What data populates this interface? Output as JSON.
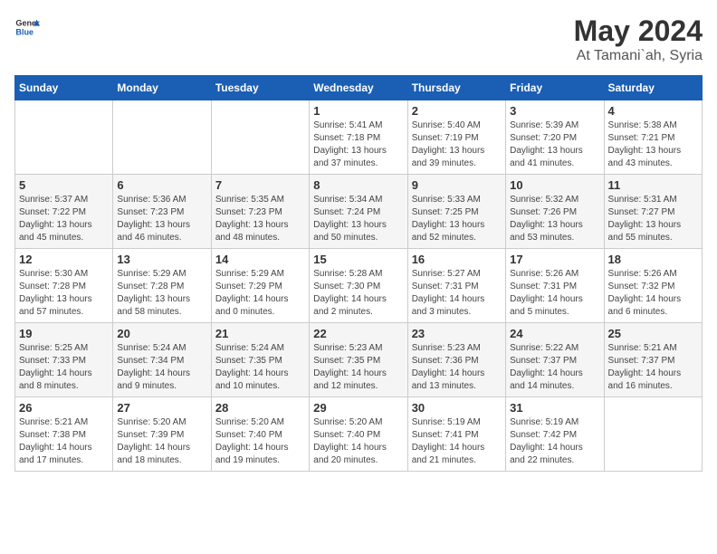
{
  "header": {
    "logo_general": "General",
    "logo_blue": "Blue",
    "month_year": "May 2024",
    "location": "At Tamani`ah, Syria"
  },
  "days_of_week": [
    "Sunday",
    "Monday",
    "Tuesday",
    "Wednesday",
    "Thursday",
    "Friday",
    "Saturday"
  ],
  "weeks": [
    [
      {
        "day": "",
        "info": ""
      },
      {
        "day": "",
        "info": ""
      },
      {
        "day": "",
        "info": ""
      },
      {
        "day": "1",
        "info": "Sunrise: 5:41 AM\nSunset: 7:18 PM\nDaylight: 13 hours\nand 37 minutes."
      },
      {
        "day": "2",
        "info": "Sunrise: 5:40 AM\nSunset: 7:19 PM\nDaylight: 13 hours\nand 39 minutes."
      },
      {
        "day": "3",
        "info": "Sunrise: 5:39 AM\nSunset: 7:20 PM\nDaylight: 13 hours\nand 41 minutes."
      },
      {
        "day": "4",
        "info": "Sunrise: 5:38 AM\nSunset: 7:21 PM\nDaylight: 13 hours\nand 43 minutes."
      }
    ],
    [
      {
        "day": "5",
        "info": "Sunrise: 5:37 AM\nSunset: 7:22 PM\nDaylight: 13 hours\nand 45 minutes."
      },
      {
        "day": "6",
        "info": "Sunrise: 5:36 AM\nSunset: 7:23 PM\nDaylight: 13 hours\nand 46 minutes."
      },
      {
        "day": "7",
        "info": "Sunrise: 5:35 AM\nSunset: 7:23 PM\nDaylight: 13 hours\nand 48 minutes."
      },
      {
        "day": "8",
        "info": "Sunrise: 5:34 AM\nSunset: 7:24 PM\nDaylight: 13 hours\nand 50 minutes."
      },
      {
        "day": "9",
        "info": "Sunrise: 5:33 AM\nSunset: 7:25 PM\nDaylight: 13 hours\nand 52 minutes."
      },
      {
        "day": "10",
        "info": "Sunrise: 5:32 AM\nSunset: 7:26 PM\nDaylight: 13 hours\nand 53 minutes."
      },
      {
        "day": "11",
        "info": "Sunrise: 5:31 AM\nSunset: 7:27 PM\nDaylight: 13 hours\nand 55 minutes."
      }
    ],
    [
      {
        "day": "12",
        "info": "Sunrise: 5:30 AM\nSunset: 7:28 PM\nDaylight: 13 hours\nand 57 minutes."
      },
      {
        "day": "13",
        "info": "Sunrise: 5:29 AM\nSunset: 7:28 PM\nDaylight: 13 hours\nand 58 minutes."
      },
      {
        "day": "14",
        "info": "Sunrise: 5:29 AM\nSunset: 7:29 PM\nDaylight: 14 hours\nand 0 minutes."
      },
      {
        "day": "15",
        "info": "Sunrise: 5:28 AM\nSunset: 7:30 PM\nDaylight: 14 hours\nand 2 minutes."
      },
      {
        "day": "16",
        "info": "Sunrise: 5:27 AM\nSunset: 7:31 PM\nDaylight: 14 hours\nand 3 minutes."
      },
      {
        "day": "17",
        "info": "Sunrise: 5:26 AM\nSunset: 7:31 PM\nDaylight: 14 hours\nand 5 minutes."
      },
      {
        "day": "18",
        "info": "Sunrise: 5:26 AM\nSunset: 7:32 PM\nDaylight: 14 hours\nand 6 minutes."
      }
    ],
    [
      {
        "day": "19",
        "info": "Sunrise: 5:25 AM\nSunset: 7:33 PM\nDaylight: 14 hours\nand 8 minutes."
      },
      {
        "day": "20",
        "info": "Sunrise: 5:24 AM\nSunset: 7:34 PM\nDaylight: 14 hours\nand 9 minutes."
      },
      {
        "day": "21",
        "info": "Sunrise: 5:24 AM\nSunset: 7:35 PM\nDaylight: 14 hours\nand 10 minutes."
      },
      {
        "day": "22",
        "info": "Sunrise: 5:23 AM\nSunset: 7:35 PM\nDaylight: 14 hours\nand 12 minutes."
      },
      {
        "day": "23",
        "info": "Sunrise: 5:23 AM\nSunset: 7:36 PM\nDaylight: 14 hours\nand 13 minutes."
      },
      {
        "day": "24",
        "info": "Sunrise: 5:22 AM\nSunset: 7:37 PM\nDaylight: 14 hours\nand 14 minutes."
      },
      {
        "day": "25",
        "info": "Sunrise: 5:21 AM\nSunset: 7:37 PM\nDaylight: 14 hours\nand 16 minutes."
      }
    ],
    [
      {
        "day": "26",
        "info": "Sunrise: 5:21 AM\nSunset: 7:38 PM\nDaylight: 14 hours\nand 17 minutes."
      },
      {
        "day": "27",
        "info": "Sunrise: 5:20 AM\nSunset: 7:39 PM\nDaylight: 14 hours\nand 18 minutes."
      },
      {
        "day": "28",
        "info": "Sunrise: 5:20 AM\nSunset: 7:40 PM\nDaylight: 14 hours\nand 19 minutes."
      },
      {
        "day": "29",
        "info": "Sunrise: 5:20 AM\nSunset: 7:40 PM\nDaylight: 14 hours\nand 20 minutes."
      },
      {
        "day": "30",
        "info": "Sunrise: 5:19 AM\nSunset: 7:41 PM\nDaylight: 14 hours\nand 21 minutes."
      },
      {
        "day": "31",
        "info": "Sunrise: 5:19 AM\nSunset: 7:42 PM\nDaylight: 14 hours\nand 22 minutes."
      },
      {
        "day": "",
        "info": ""
      }
    ]
  ]
}
